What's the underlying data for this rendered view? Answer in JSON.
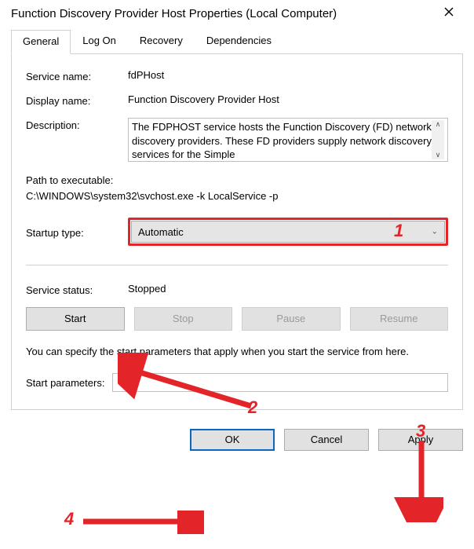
{
  "window": {
    "title": "Function Discovery Provider Host Properties (Local Computer)"
  },
  "tabs": {
    "general": "General",
    "logon": "Log On",
    "recovery": "Recovery",
    "dependencies": "Dependencies"
  },
  "labels": {
    "service_name": "Service name:",
    "display_name": "Display name:",
    "description": "Description:",
    "path": "Path to executable:",
    "startup_type": "Startup type:",
    "service_status": "Service status:",
    "start_parameters": "Start parameters:"
  },
  "values": {
    "service_name": "fdPHost",
    "display_name": "Function Discovery Provider Host",
    "description": "The FDPHOST service hosts the Function Discovery (FD) network discovery providers. These FD providers supply network discovery services for the Simple",
    "path": "C:\\WINDOWS\\system32\\svchost.exe -k LocalService -p",
    "startup_type": "Automatic",
    "service_status": "Stopped",
    "start_parameters": ""
  },
  "buttons": {
    "start": "Start",
    "stop": "Stop",
    "pause": "Pause",
    "resume": "Resume",
    "ok": "OK",
    "cancel": "Cancel",
    "apply": "Apply"
  },
  "hint": "You can specify the start parameters that apply when you start the service from here.",
  "annotations": {
    "n1": "1",
    "n2": "2",
    "n3": "3",
    "n4": "4"
  }
}
